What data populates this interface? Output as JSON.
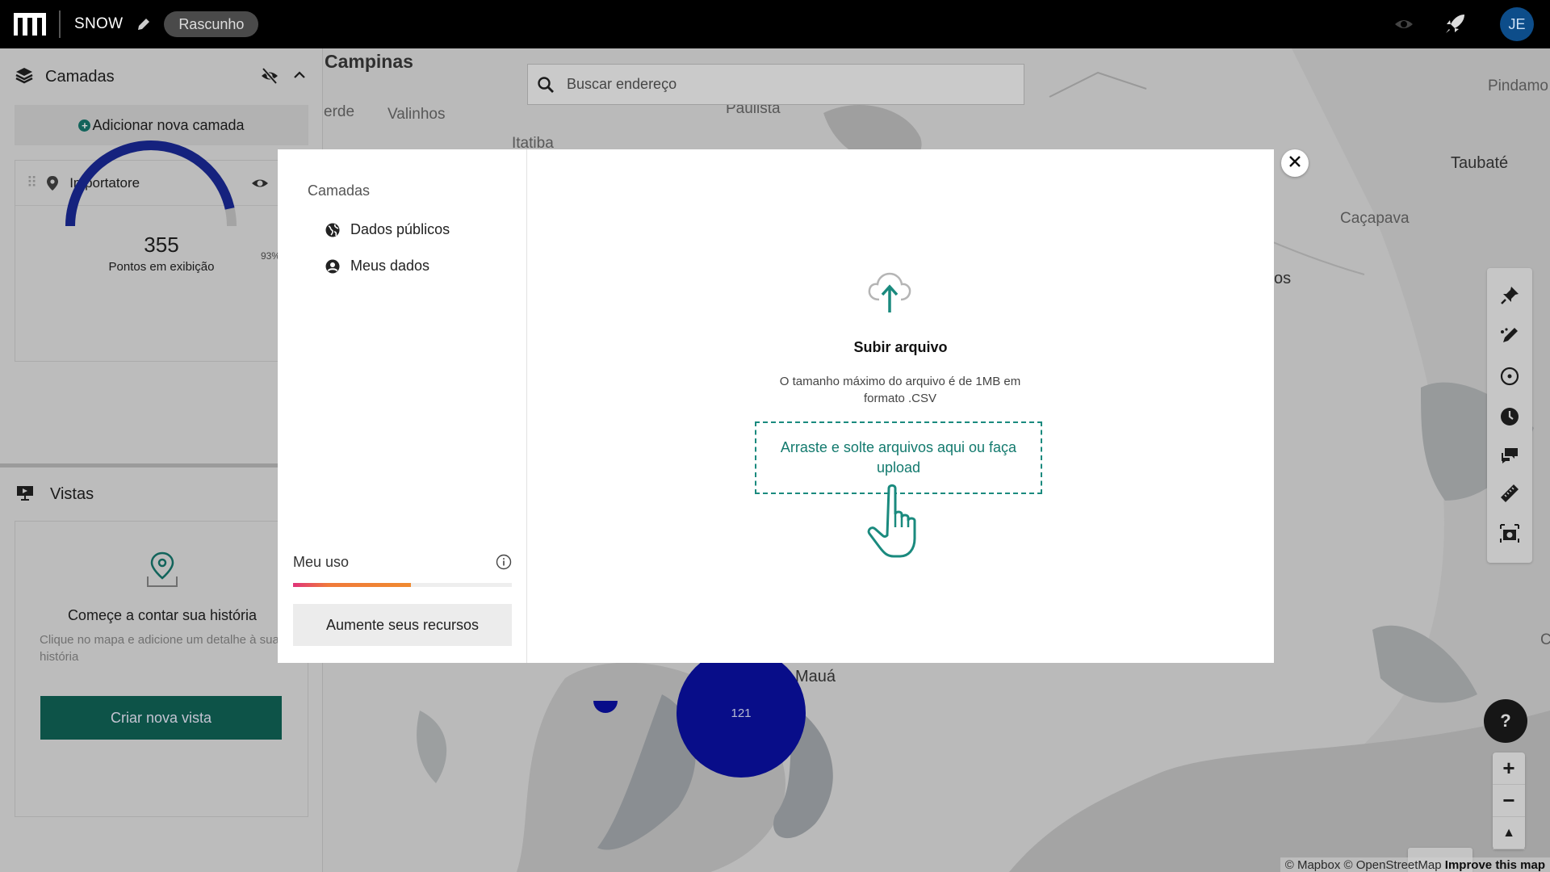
{
  "topbar": {
    "project_name": "SNOW",
    "status_pill": "Rascunho",
    "avatar_initials": "JE"
  },
  "map": {
    "search_placeholder": "Buscar endereço",
    "labels": {
      "campinas": "Campinas",
      "erde": "erde",
      "valinhos": "Valinhos",
      "paulista": "Paulista",
      "itatiba": "Itatiba",
      "pindamo": "Pindamo",
      "taubate": "Taubaté",
      "cacapava": "Caçapava",
      "os": "os",
      "maua": "Mauá",
      "c_edge": "C"
    },
    "cluster_count": "121",
    "help_label": "?",
    "zoom_in": "+",
    "zoom_out": "−",
    "compass": "▲",
    "mapbox_logo": "mapbox",
    "attribution": {
      "mapbox": "© Mapbox",
      "osm": "© OpenStreetMap",
      "improve": "Improve this map"
    }
  },
  "left_panel": {
    "layers_title": "Camadas",
    "add_layer_label": "Adicionar nova camada",
    "layer": {
      "name": "Importatore",
      "points_count": "355",
      "points_label": "Pontos em exibição",
      "side_value": "93%",
      "gauge_fraction": 0.93
    },
    "views_title": "Vistas",
    "views_card": {
      "title": "Começe a contar sua história",
      "description": "Clique no mapa e adicione um detalhe à sua história",
      "button": "Criar nova vista"
    }
  },
  "modal": {
    "side": {
      "title": "Camadas",
      "items": [
        {
          "label": "Dados públicos",
          "icon": "globe-icon"
        },
        {
          "label": "Meus dados",
          "icon": "user-circle-icon"
        }
      ],
      "usage_label": "Meu uso",
      "usage_fraction": 0.54,
      "upgrade_button": "Aumente seus recursos"
    },
    "main": {
      "title": "Subir arquivo",
      "description": "O tamanho máximo do arquivo é de 1MB em formato .CSV",
      "dropzone": "Arraste e solte arquivos aqui ou faça upload"
    }
  },
  "colors": {
    "accent": "#106658",
    "dropzone": "#1a8a7e",
    "cluster": "#0a11a8",
    "gauge": "#1a2a9a"
  }
}
